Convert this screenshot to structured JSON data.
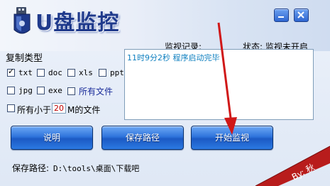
{
  "app": {
    "title": "U盘监控",
    "colors": {
      "accent": "#1f3a8c",
      "button": "#2f74dc",
      "log_text": "#1080c0",
      "arrow": "#d01818"
    }
  },
  "window_controls": {
    "minimize_icon": "minimize-icon",
    "close_icon": "close-icon"
  },
  "status": {
    "text": "状态: 监视未开启"
  },
  "log": {
    "label": "监视记录:",
    "entries": [
      "11时9分2秒  程序启动完毕"
    ]
  },
  "copy_types": {
    "label": "复制类型",
    "options": [
      {
        "label": "txt",
        "checked": true
      },
      {
        "label": "doc",
        "checked": false
      },
      {
        "label": "xls",
        "checked": false
      },
      {
        "label": "ppt",
        "checked": false
      },
      {
        "label": "jpg",
        "checked": false
      },
      {
        "label": "exe",
        "checked": false
      },
      {
        "label": "所有文件",
        "checked": false
      }
    ]
  },
  "size_filter": {
    "checked": false,
    "prefix": "所有小于",
    "value": "20",
    "suffix": "M的文件"
  },
  "buttons": {
    "help": "说明",
    "save_path": "保存路径",
    "start": "开始监视"
  },
  "save_path": {
    "label": "保存路径:",
    "value": "D:\\tools\\桌面\\下载吧"
  },
  "corner_badge": {
    "text": "By: 秋"
  }
}
